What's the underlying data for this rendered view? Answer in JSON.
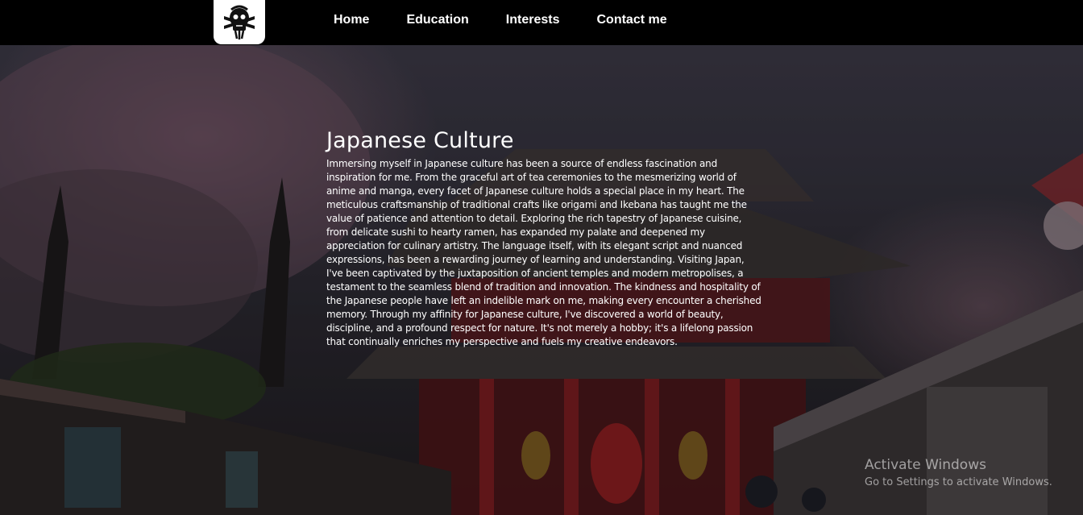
{
  "nav": {
    "logo_icon": "skull-logo-icon",
    "links": [
      "Home",
      "Education",
      "Interests",
      "Contact me"
    ]
  },
  "main": {
    "title": "Japanese Culture",
    "paragraph": "Immersing myself in Japanese culture has been a source of endless fascination and inspiration for me. From the graceful art of tea ceremonies to the mesmerizing world of anime and manga, every facet of Japanese culture holds a special place in my heart. The meticulous craftsmanship of traditional crafts like origami and Ikebana has taught me the value of patience and attention to detail. Exploring the rich tapestry of Japanese cuisine, from delicate sushi to hearty ramen, has expanded my palate and deepened my appreciation for culinary artistry. The language itself, with its elegant script and nuanced expressions, has been a rewarding journey of learning and understanding. Visiting Japan, I've been captivated by the juxtaposition of ancient temples and modern metropolises, a testament to the seamless blend of tradition and innovation. The kindness and hospitality of the Japanese people have left an indelible mark on me, making every encounter a cherished memory. Through my affinity for Japanese culture, I've discovered a world of beauty, discipline, and a profound respect for nature. It's not merely a hobby; it's a lifelong passion that continually enriches my perspective and fuels my creative endeavors."
  },
  "watermark": {
    "title": "Activate Windows",
    "subtitle": "Go to Settings to activate Windows."
  },
  "colors": {
    "navbar": "#000000",
    "text": "#ffffff",
    "temple_red": "#8a1f22"
  }
}
